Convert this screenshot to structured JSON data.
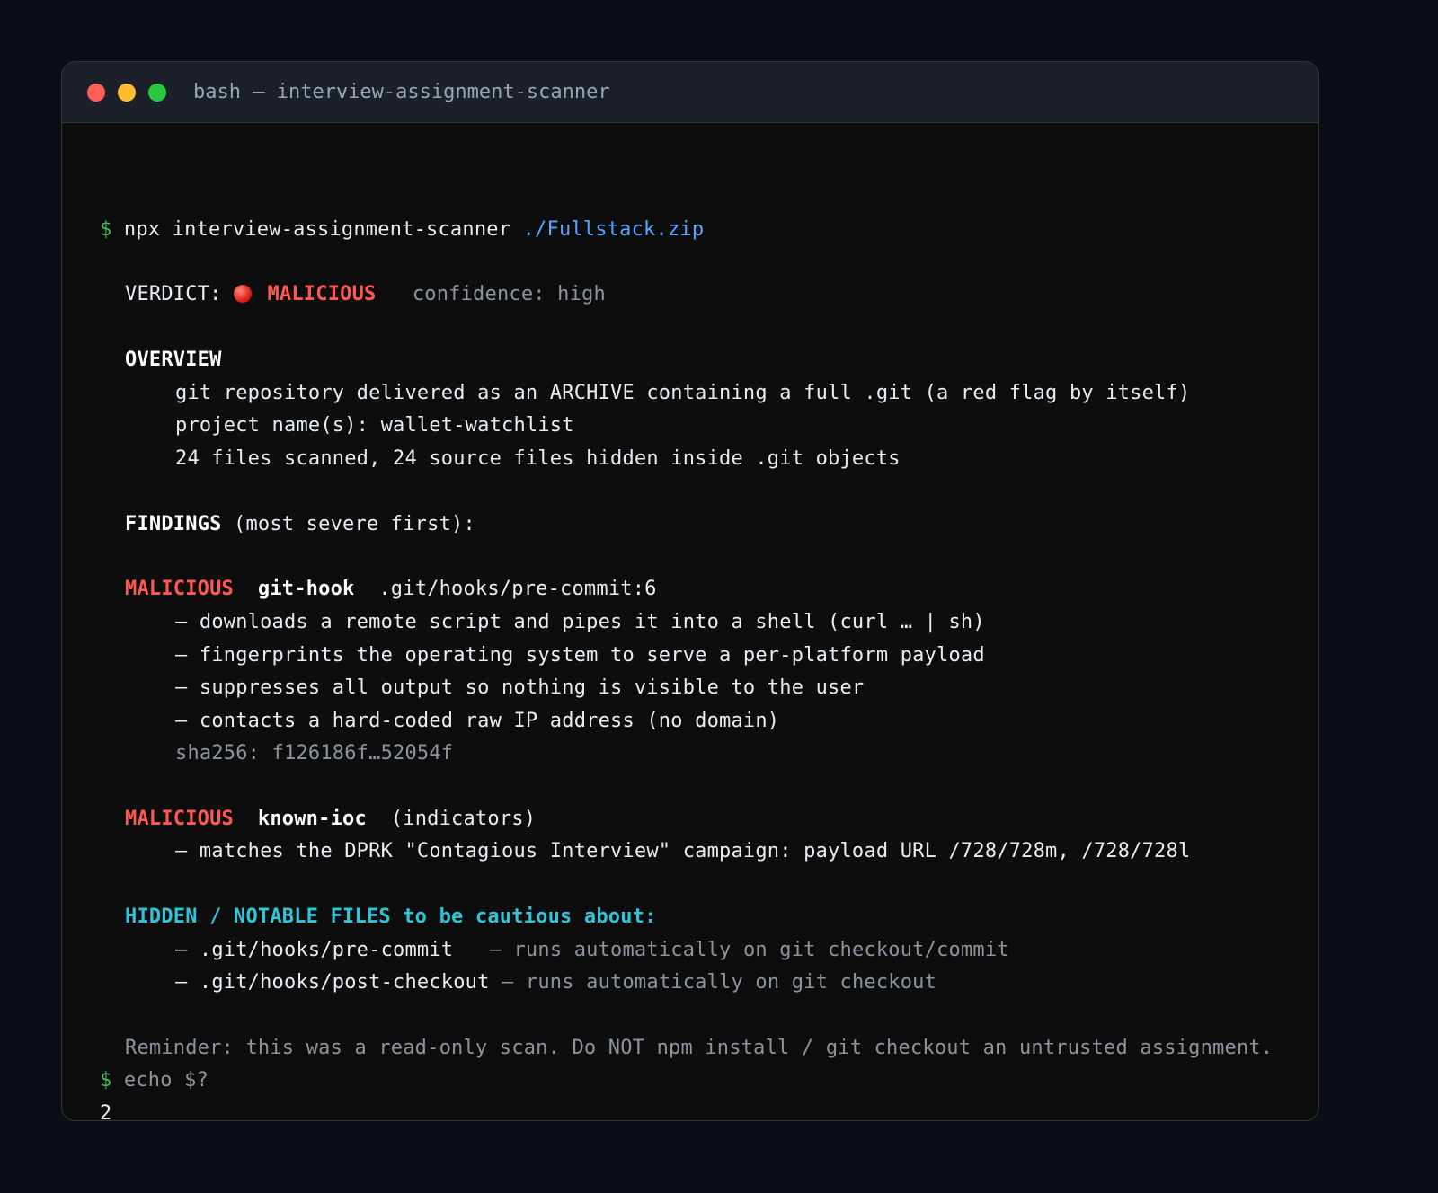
{
  "window": {
    "title": "bash — interview-assignment-scanner"
  },
  "terminal": {
    "prompt_symbol": "$",
    "command": {
      "text": "npx interview-assignment-scanner",
      "argument": "./Fullstack.zip"
    },
    "verdict": {
      "label": "VERDICT:",
      "icon": "red-circle-icon",
      "value": "MALICIOUS",
      "confidence": "confidence: high"
    },
    "overview": {
      "heading": "OVERVIEW",
      "lines": [
        "git repository delivered as an ARCHIVE containing a full .git (a red flag by itself)",
        "project name(s): wallet-watchlist",
        "24 files scanned, 24 source files hidden inside .git objects"
      ]
    },
    "findings": {
      "heading": "FINDINGS",
      "subheading": " (most severe first):",
      "items": [
        {
          "severity": "MALICIOUS",
          "rule": "git-hook",
          "location": ".git/hooks/pre-commit:6",
          "details": [
            "– downloads a remote script and pipes it into a shell (curl … | sh)",
            "– fingerprints the operating system to serve a per-platform payload",
            "– suppresses all output so nothing is visible to the user",
            "– contacts a hard-coded raw IP address (no domain)"
          ],
          "hash": "sha256: f126186f…52054f"
        },
        {
          "severity": "MALICIOUS",
          "rule": "known-ioc",
          "location": "(indicators)",
          "details": [
            "– matches the DPRK \"Contagious Interview\" campaign: payload URL /728/728m, /728/728l"
          ]
        }
      ]
    },
    "hidden_files": {
      "heading": "HIDDEN / NOTABLE FILES to be cautious about:",
      "items": [
        {
          "path": "– .git/hooks/pre-commit",
          "note": "– runs automatically on git checkout/commit"
        },
        {
          "path": "– .git/hooks/post-checkout",
          "note": "– runs automatically on git checkout"
        }
      ]
    },
    "reminder": "Reminder: this was a read-only scan. Do NOT npm install / git checkout an untrusted assignment.",
    "second_command": "echo $?",
    "exit_code": "2"
  },
  "colors": {
    "background": "#0b0f15",
    "terminal_bg": "#0d0d0d",
    "prompt": "#3fb950",
    "path": "#58a6ff",
    "malicious": "#ff5a52",
    "cyan": "#2fc4d8",
    "dim": "#8b949e"
  }
}
